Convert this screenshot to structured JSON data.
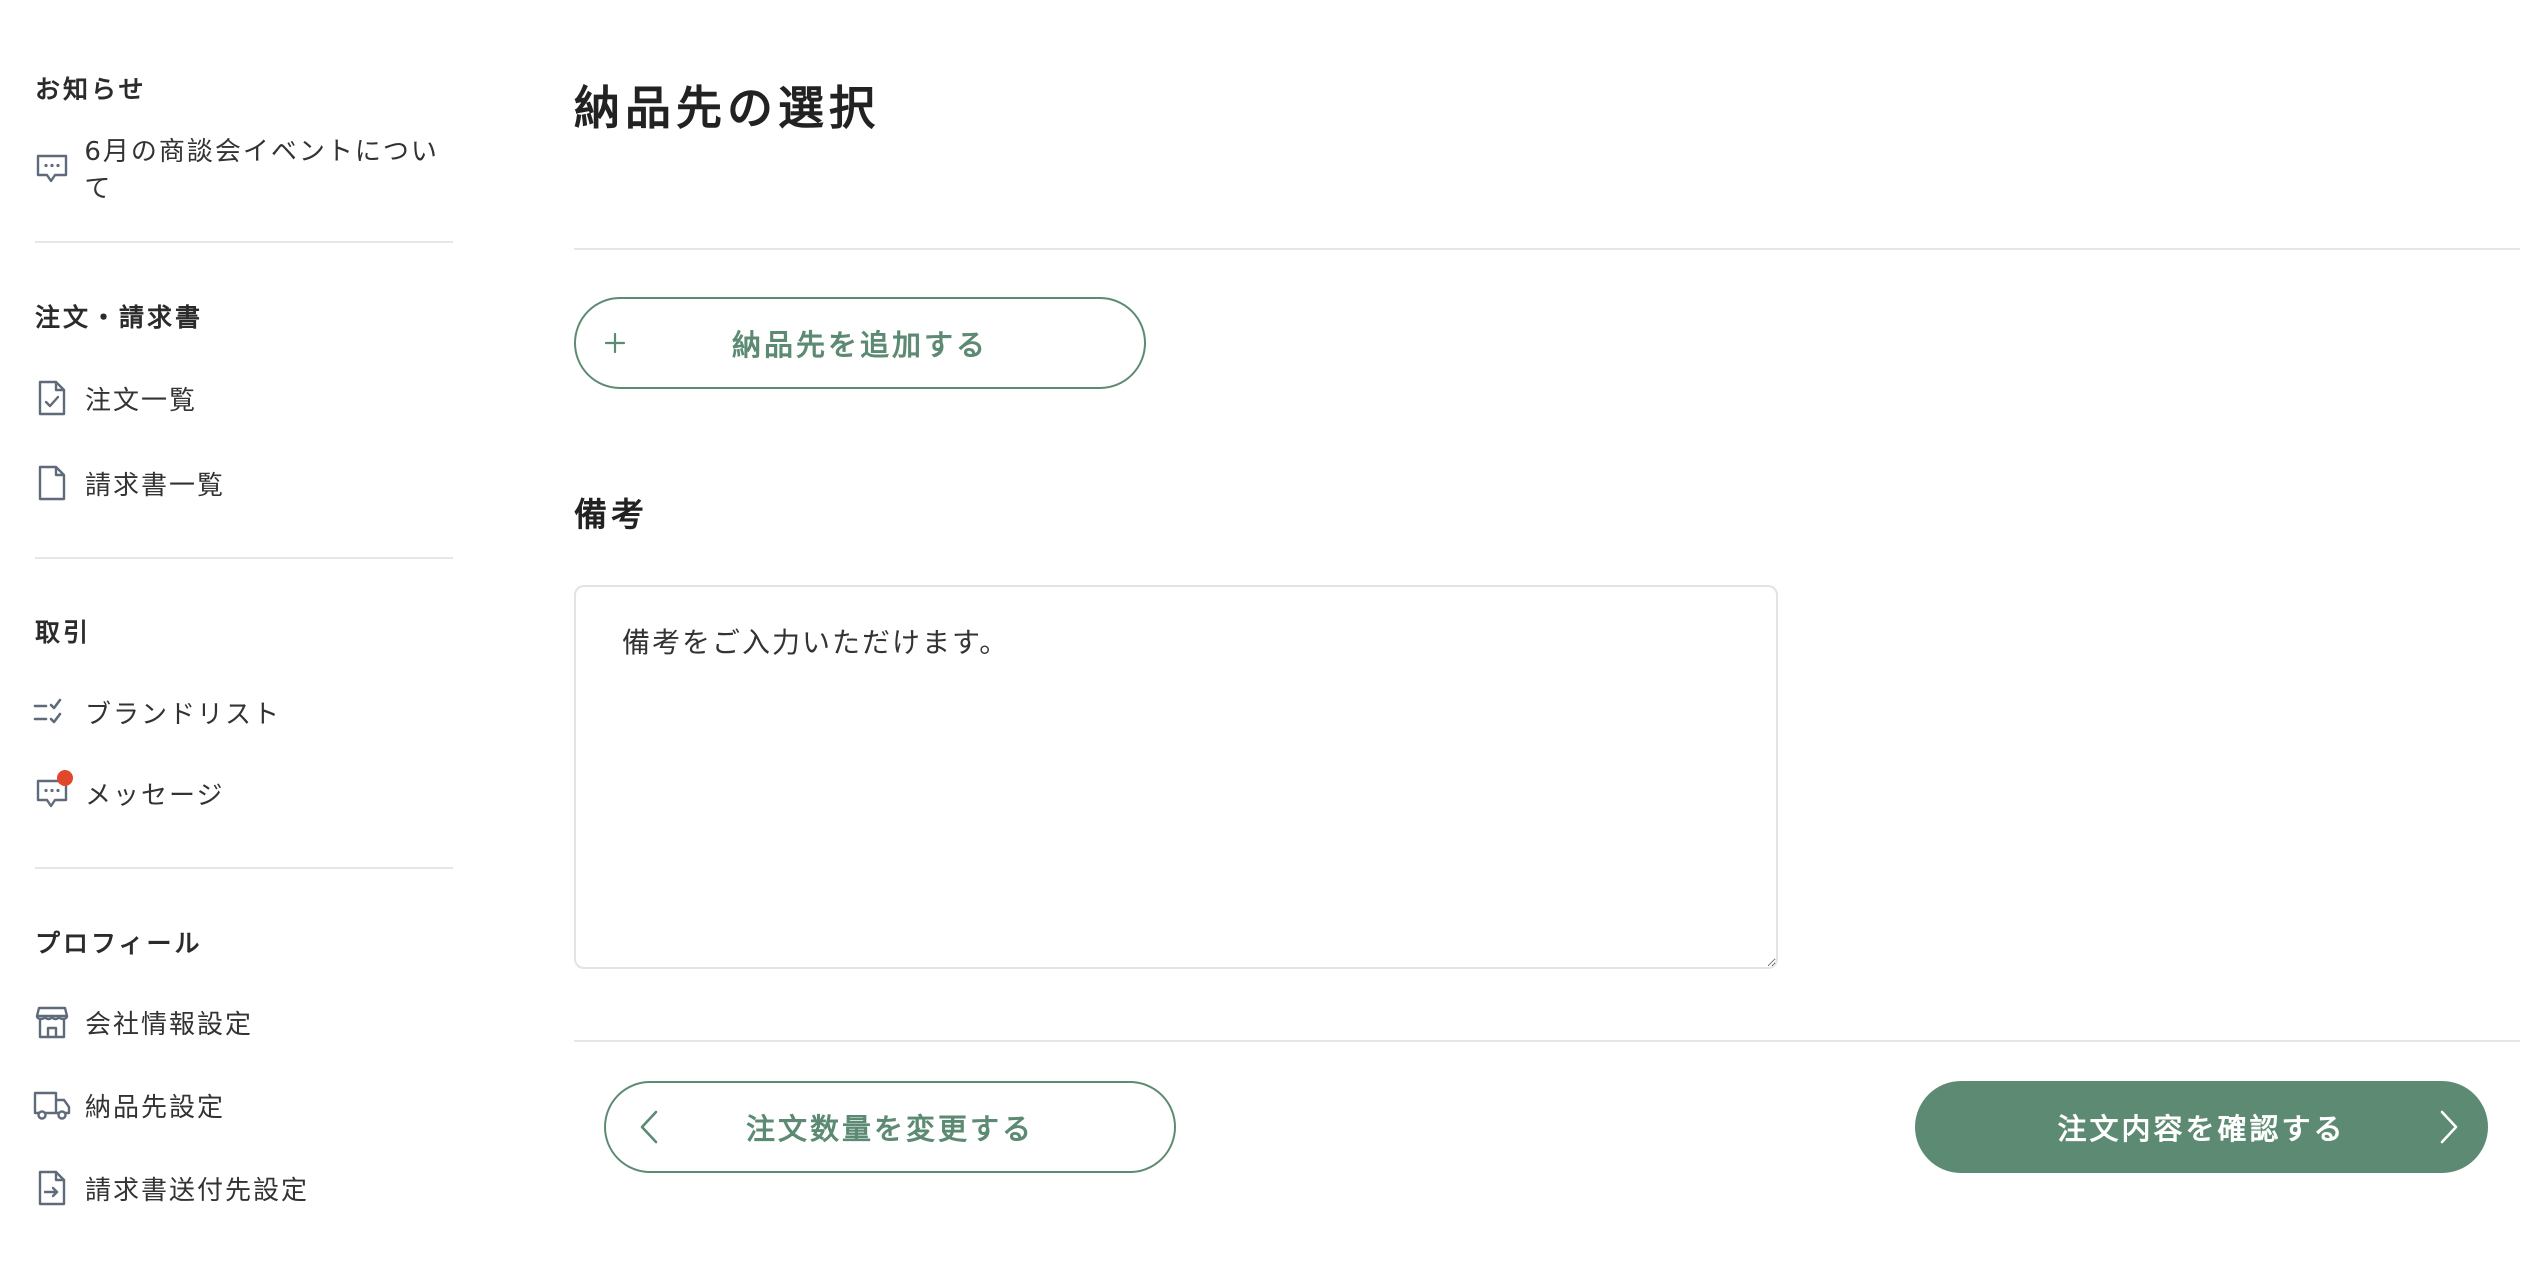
{
  "sidebar": {
    "news": {
      "title": "お知らせ",
      "items": [
        {
          "label": "6月の商談会イベントについて",
          "icon": "chat-bubble-icon"
        }
      ]
    },
    "orders": {
      "title": "注文・請求書",
      "items": [
        {
          "label": "注文一覧",
          "icon": "document-check-icon"
        },
        {
          "label": "請求書一覧",
          "icon": "document-icon"
        }
      ]
    },
    "trade": {
      "title": "取引",
      "items": [
        {
          "label": "ブランドリスト",
          "icon": "checklist-icon"
        },
        {
          "label": "メッセージ",
          "icon": "chat-bubble-icon",
          "has_notification": true
        }
      ]
    },
    "profile": {
      "title": "プロフィール",
      "items": [
        {
          "label": "会社情報設定",
          "icon": "storefront-icon"
        },
        {
          "label": "納品先設定",
          "icon": "truck-icon"
        },
        {
          "label": "請求書送付先設定",
          "icon": "document-arrow-icon"
        }
      ]
    }
  },
  "main": {
    "title": "納品先の選択",
    "add_address_button": {
      "label": "納品先を追加する",
      "icon": "plus-icon"
    },
    "remarks": {
      "label": "備考",
      "placeholder": "備考をご入力いただけます。",
      "value": ""
    },
    "back_button": {
      "label": "注文数量を変更する",
      "icon": "chevron-left-icon"
    },
    "confirm_button": {
      "label": "注文内容を確認する",
      "icon": "chevron-right-icon"
    }
  },
  "colors": {
    "accent": "#5d8a72",
    "notification": "#e0472b",
    "icon": "#5f6b7a",
    "divider": "#e6e6e6"
  }
}
